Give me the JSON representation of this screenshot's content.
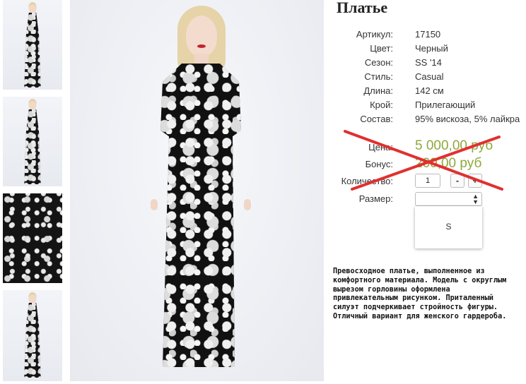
{
  "product": {
    "title": "Платье",
    "specs": [
      {
        "label": "Артикул:",
        "value": "17150"
      },
      {
        "label": "Цвет:",
        "value": "Черный"
      },
      {
        "label": "Сезон:",
        "value": "SS '14"
      },
      {
        "label": "Стиль:",
        "value": "Casual"
      },
      {
        "label": "Длина:",
        "value": "142 см"
      },
      {
        "label": "Крой:",
        "value": "Прилегающий"
      },
      {
        "label": "Состав:",
        "value": "95% вискоза, 5% лайкра"
      }
    ],
    "price": {
      "label": "Цена:",
      "value": "5 000,00 руб"
    },
    "bonus": {
      "label": "Бонус:",
      "value": "200,00 руб"
    },
    "quantity": {
      "label": "Количество:",
      "value": "1",
      "minus": "-",
      "plus": "+"
    },
    "size": {
      "label": "Размер:",
      "selected": "",
      "options": [
        "S"
      ]
    },
    "description": "Превосходное платье, выполненное из комфортного материала. Модель с округлым вырезом горловины оформлена привлекательным рисунком. Приталенный силуэт подчеркивает стройность фигуры. Отличный вариант для женского гардероба."
  },
  "colors": {
    "accent_price": "#8fa83a",
    "cross": "#e03030"
  },
  "icons": {
    "select_arrow": "updown-arrow-icon"
  }
}
